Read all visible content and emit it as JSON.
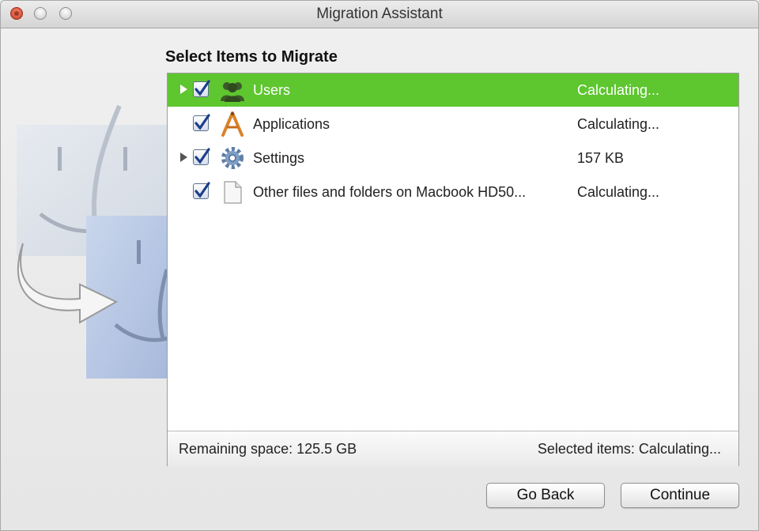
{
  "window": {
    "title": "Migration Assistant"
  },
  "heading": "Select Items to Migrate",
  "items": [
    {
      "label": "Users",
      "status": "Calculating...",
      "checked": true,
      "selected": true,
      "expandable": true,
      "icon": "users-icon"
    },
    {
      "label": "Applications",
      "status": "Calculating...",
      "checked": true,
      "selected": false,
      "expandable": false,
      "icon": "applications-icon"
    },
    {
      "label": "Settings",
      "status": "157 KB",
      "checked": true,
      "selected": false,
      "expandable": true,
      "icon": "gear-icon"
    },
    {
      "label": "Other files and folders on Macbook HD50...",
      "status": "Calculating...",
      "checked": true,
      "selected": false,
      "expandable": false,
      "icon": "document-icon"
    }
  ],
  "footer": {
    "remaining": "Remaining space: 125.5 GB",
    "selected": "Selected items: Calculating..."
  },
  "buttons": {
    "back": "Go Back",
    "continue": "Continue"
  },
  "colors": {
    "selection": "#5ec62f",
    "checkmark": "#1b3f8a"
  }
}
